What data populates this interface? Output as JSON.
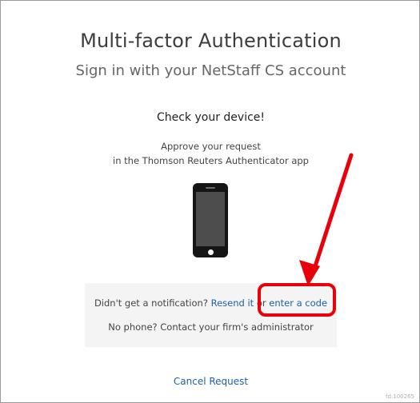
{
  "page": {
    "title": "Multi-factor Authentication",
    "subtitle": "Sign in with your NetStaff CS account"
  },
  "device": {
    "heading": "Check your device!",
    "instruction_line1": "Approve your request",
    "instruction_line2": "in the Thomson Reuters Authenticator app",
    "icon": "smartphone-icon"
  },
  "help": {
    "notification_prefix": "Didn't get a notification? ",
    "resend_link": "Resend it",
    "or_text": " or ",
    "enter_code_link": "enter a code",
    "no_phone_text": "No phone? Contact your firm's administrator"
  },
  "footer": {
    "cancel_label": "Cancel Request",
    "fid": "fd:100265"
  },
  "colors": {
    "link": "#1f5fa8",
    "annotation": "#e8000b",
    "help_background": "#f4f4f4"
  }
}
